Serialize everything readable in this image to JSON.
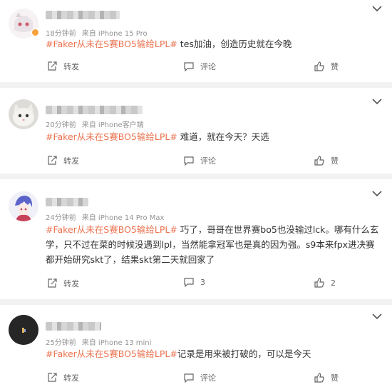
{
  "comments": [
    {
      "time": "18分钟前",
      "source": "来自 iPhone 15 Pro",
      "hashtag": "#Faker从未在S赛BO5输给LPL#",
      "text": " tes加油，创造历史就在今晚",
      "actions": {
        "repost": "转发",
        "comment": "评论",
        "like": "赞"
      }
    },
    {
      "time": "20分钟前",
      "source": "来自 iPhone客户端",
      "hashtag": "#Faker从未在S赛BO5输给LPL#",
      "text": " 难道，就在今天？天选",
      "actions": {
        "repost": "转发",
        "comment": "评论",
        "like": "赞"
      }
    },
    {
      "time": "24分钟前",
      "source": "来自 iPhone 14 Pro Max",
      "hashtag": "#Faker从未在S赛BO5输给LPL#",
      "text": " 巧了，哥哥在世界赛bo5也没输过lck。哪有什么玄学，只不过在菜的时候没遇到lpl，当然能拿冠军也是真的因为强。s9本来fpx进决赛都开始研究skt了，结果skt第二天就回家了",
      "actions": {
        "repost": "转发",
        "comment": "3",
        "like": "2"
      }
    },
    {
      "time": "25分钟前",
      "source": "来自 iPhone 13 mini",
      "hashtag": "#Faker从未在S赛BO5输给LPL#",
      "text": "记录是用来被打破的，可以是今天",
      "actions": {
        "repost": "转发",
        "comment": "评论",
        "like": "赞"
      }
    }
  ],
  "colors": {
    "hashtag": "#eb7350",
    "meta": "#939393",
    "background": "#f2f2f2"
  }
}
